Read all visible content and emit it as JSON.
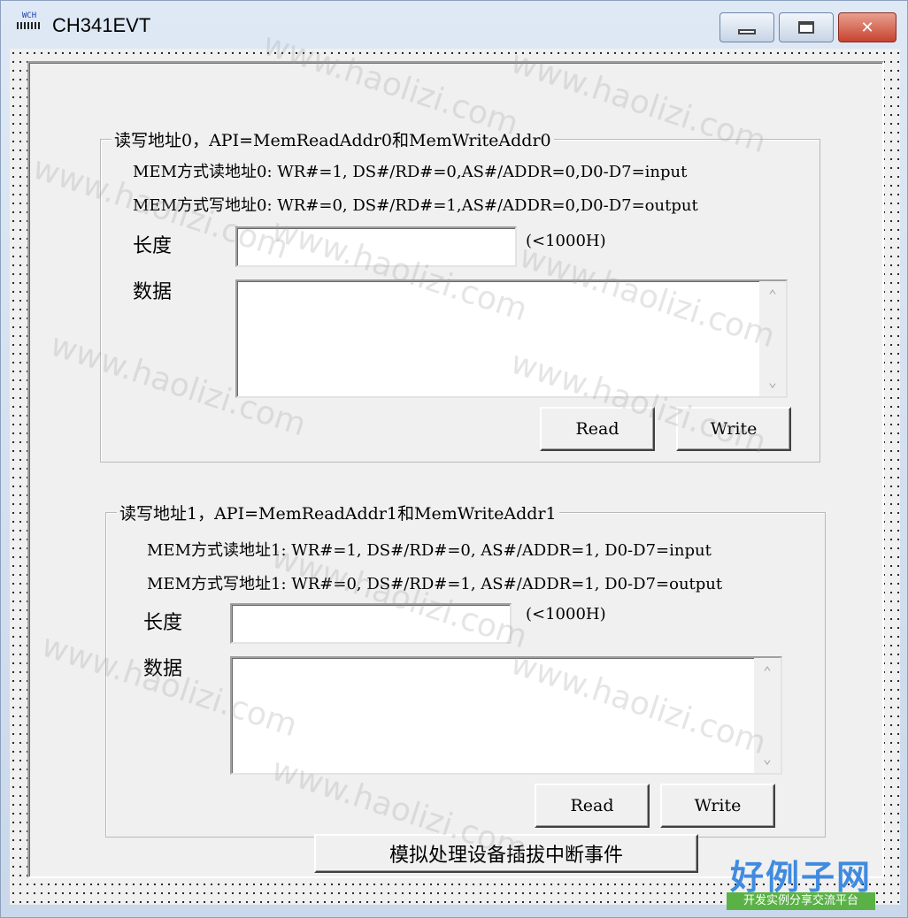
{
  "window": {
    "title": "CH341EVT",
    "icon_label": "WCH",
    "minimize_label": "minimize",
    "maximize_label": "maximize",
    "close_label": "✕"
  },
  "group0": {
    "caption": "读写地址0，API=MemReadAddr0和MemWriteAddr0",
    "read_desc": "MEM方式读地址0: WR#=1, DS#/RD#=0,AS#/ADDR=0,D0-D7=input",
    "write_desc": "MEM方式写地址0: WR#=0, DS#/RD#=1,AS#/ADDR=0,D0-D7=output",
    "length_label": "长度",
    "length_value": "",
    "length_hint": "(<1000H)",
    "data_label": "数据",
    "data_value": "",
    "read_button": "Read",
    "write_button": "Write"
  },
  "group1": {
    "caption": "读写地址1，API=MemReadAddr1和MemWriteAddr1",
    "read_desc": "MEM方式读地址1: WR#=1, DS#/RD#=0, AS#/ADDR=1, D0-D7=input",
    "write_desc": "MEM方式写地址1: WR#=0, DS#/RD#=1, AS#/ADDR=1, D0-D7=output",
    "length_label": "长度",
    "length_value": "",
    "length_hint": "(<1000H)",
    "data_label": "数据",
    "data_value": "",
    "read_button": "Read",
    "write_button": "Write"
  },
  "simulate_button": "模拟处理设备插拔中断事件",
  "watermark_text": "www.haolizi.com",
  "brand": {
    "name": "好例子网",
    "tagline": "开发实例分享交流平台"
  },
  "colors": {
    "dialog_bg": "#f0f0f0",
    "close_button": "#c7432e",
    "brand_blue": "#3f8be0",
    "brand_green": "#5ab246"
  }
}
